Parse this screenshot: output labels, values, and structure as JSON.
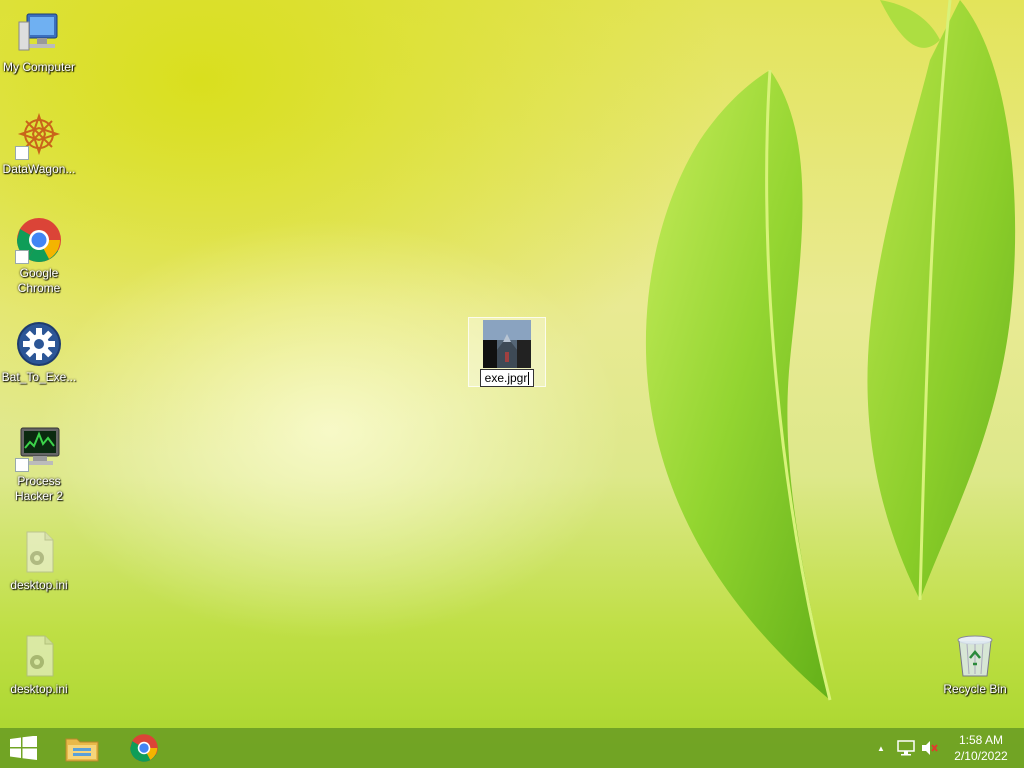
{
  "desktop": {
    "icons": [
      {
        "label": "My Computer",
        "icon": "computer-icon"
      },
      {
        "label": "DataWagon...",
        "icon": "datawagon-icon"
      },
      {
        "label": "Google Chrome",
        "icon": "chrome-icon"
      },
      {
        "label": "Bat_To_Exe...",
        "icon": "gear-icon"
      },
      {
        "label": "Process Hacker 2",
        "icon": "process-hacker-icon"
      },
      {
        "label": "desktop.ini",
        "icon": "ini-file-icon"
      },
      {
        "label": "desktop.ini",
        "icon": "ini-file-icon"
      },
      {
        "label": "Recycle Bin",
        "icon": "recycle-bin-icon"
      }
    ],
    "selected_file": {
      "icon": "image-thumbnail-icon",
      "rename_value": "exe.jpgr"
    }
  },
  "taskbar": {
    "start_icon": "windows-start-icon",
    "pinned": [
      {
        "name": "file-explorer",
        "icon": "folder-icon"
      },
      {
        "name": "google-chrome",
        "icon": "chrome-icon"
      }
    ],
    "tray": {
      "chevron": "▲",
      "icons": [
        "network-icon",
        "volume-muted-icon"
      ]
    },
    "clock": {
      "time": "1:58 AM",
      "date": "2/10/2022"
    }
  },
  "colors": {
    "taskbar": "#6ca024",
    "wallpaper_top": "#e3e45a",
    "wallpaper_bottom": "#a6d52a",
    "leaf": "#8ccf2a"
  }
}
